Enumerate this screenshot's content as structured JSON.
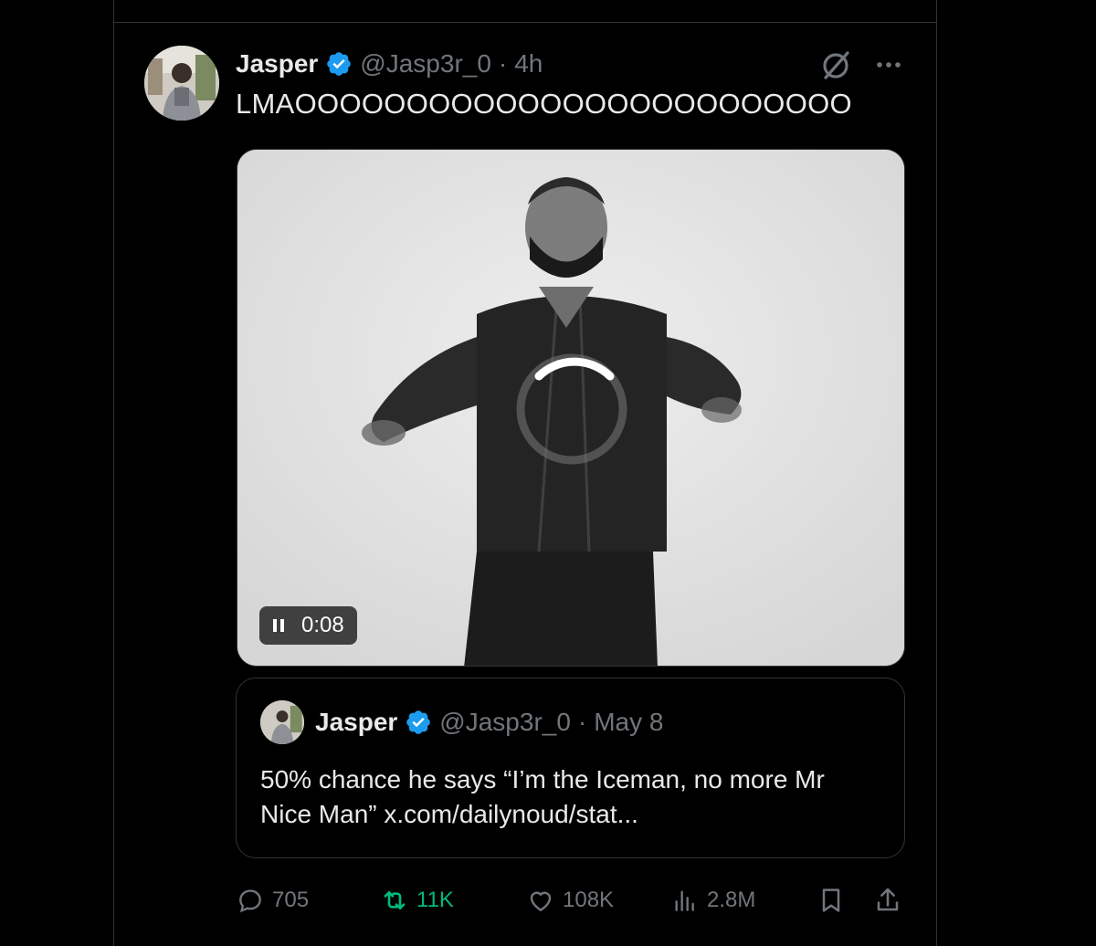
{
  "tweet": {
    "author_name": "Jasper",
    "handle": "@Jasp3r_0",
    "separator": "·",
    "time": "4h",
    "text": "LMAOOOOOOOOOOOOOOOOOOOOOOOOO",
    "icons": [
      "verified-badge-icon",
      "grok-icon",
      "more-icon"
    ]
  },
  "video": {
    "state": "loading",
    "timestamp": "0:08",
    "icons": [
      "loading-spinner-icon",
      "pause-icon"
    ]
  },
  "quote": {
    "author_name": "Jasper",
    "handle": "@Jasp3r_0",
    "separator": "·",
    "time": "May 8",
    "text": "50% chance he says “I’m the Iceman, no more Mr Nice Man” x.com/dailynoud/stat..."
  },
  "actions": {
    "replies": "705",
    "reposts": "11K",
    "likes": "108K",
    "views": "2.8M",
    "icons": [
      "reply-icon",
      "repost-icon",
      "like-icon",
      "views-icon",
      "bookmark-icon",
      "share-icon"
    ]
  },
  "colors": {
    "background": "#000000",
    "text": "#e7e9ea",
    "muted": "#71767b",
    "border": "#2f3336",
    "verified": "#1d9bf0",
    "repost_active": "#00ba7c"
  }
}
